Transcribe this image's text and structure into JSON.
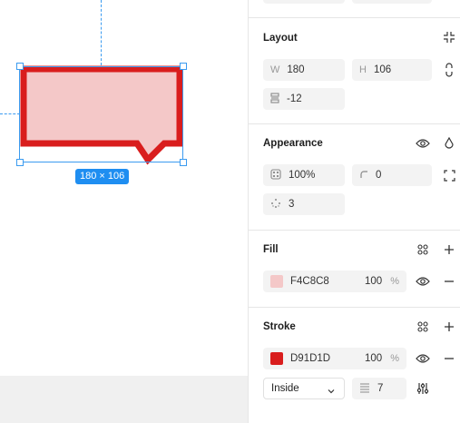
{
  "canvas": {
    "dimension_badge": "180 × 106",
    "shape_fill": "#F4C8C8",
    "shape_stroke": "#D91D1D"
  },
  "layout": {
    "title": "Layout",
    "width_label": "W",
    "width": "180",
    "height_label": "H",
    "height": "106",
    "gap": "-12"
  },
  "appearance": {
    "title": "Appearance",
    "opacity": "100%",
    "radius": "0",
    "corner_smoothing": "3"
  },
  "fill": {
    "title": "Fill",
    "hex": "F4C8C8",
    "color": "#F4C8C8",
    "opacity": "100",
    "unit": "%"
  },
  "stroke": {
    "title": "Stroke",
    "hex": "D91D1D",
    "color": "#D91D1D",
    "opacity": "100",
    "unit": "%",
    "position": "Inside",
    "weight": "7"
  }
}
